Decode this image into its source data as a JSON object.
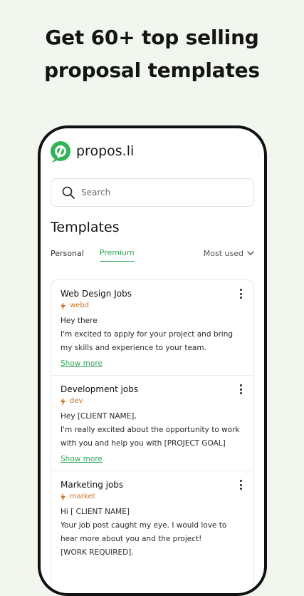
{
  "headline": {
    "line1": "Get 60+ top selling",
    "line2": "proposal templates"
  },
  "app": {
    "brand": "propos.li",
    "accent_color": "#2fb457",
    "tag_color": "#d2701d"
  },
  "search": {
    "placeholder": "Search",
    "icon": "search-icon"
  },
  "section_title": "Templates",
  "tabs": [
    {
      "label": "Personal",
      "active": false
    },
    {
      "label": "Premium",
      "active": true
    }
  ],
  "sort": {
    "label": "Most used",
    "icon": "chevron-down-icon"
  },
  "templates": [
    {
      "title": "Web Design Jobs",
      "tag": "webd",
      "body": "Hey there\nI'm excited to apply for your project and bring my skills and experience to your team.",
      "show_more": "Show more"
    },
    {
      "title": "Development jobs",
      "tag": "dev",
      "body": "Hey [CLIENT NAME],\nI'm really excited about the opportunity to work with you and help you with [PROJECT GOAL]",
      "show_more": "Show more"
    },
    {
      "title": "Marketing jobs",
      "tag": "market",
      "body": "Hi [ CLIENT NAME]\nYour job post caught my eye. I would love to hear more about you and the project!\n[WORK REQUIRED].",
      "show_more": ""
    }
  ]
}
